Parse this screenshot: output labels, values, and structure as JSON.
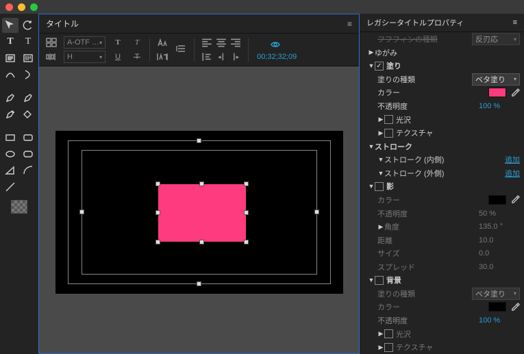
{
  "window": {
    "title": ""
  },
  "panel_title": "タイトル",
  "toolbar": {
    "font_family": "A-OTF …",
    "font_style": "H",
    "timecode": "00;32;32;09"
  },
  "props_title": "レガシータイトルプロパティ",
  "truncated_label": "フフフィンの種類",
  "truncated_value": "反刃応",
  "distort": {
    "label": "ゆがみ"
  },
  "fill": {
    "label": "塗り",
    "type_label": "塗りの種類",
    "type_value": "ベタ塗り",
    "color_label": "カラー",
    "color_value": "#ff3b7f",
    "opacity_label": "不透明度",
    "opacity_value": "100 %",
    "sheen_label": "光沢",
    "texture_label": "テクスチャ"
  },
  "stroke": {
    "label": "ストローク",
    "inner_label": "ストローク (内側)",
    "outer_label": "ストローク (外側)",
    "add_label": "追加"
  },
  "shadow": {
    "label": "影",
    "color_label": "カラー",
    "color_value": "#000000",
    "opacity_label": "不透明度",
    "opacity_value": "50 %",
    "angle_label": "角度",
    "angle_value": "135.0 °",
    "distance_label": "距離",
    "distance_value": "10.0",
    "size_label": "サイズ",
    "size_value": "0.0",
    "spread_label": "スプレッド",
    "spread_value": "30.0"
  },
  "bg": {
    "label": "背景",
    "type_label": "塗りの種類",
    "type_value": "ベタ塗り",
    "color_label": "カラー",
    "color_value": "#000000",
    "opacity_label": "不透明度",
    "opacity_value": "100 %",
    "sheen_label": "光沢",
    "texture_label": "テクスチャ"
  }
}
